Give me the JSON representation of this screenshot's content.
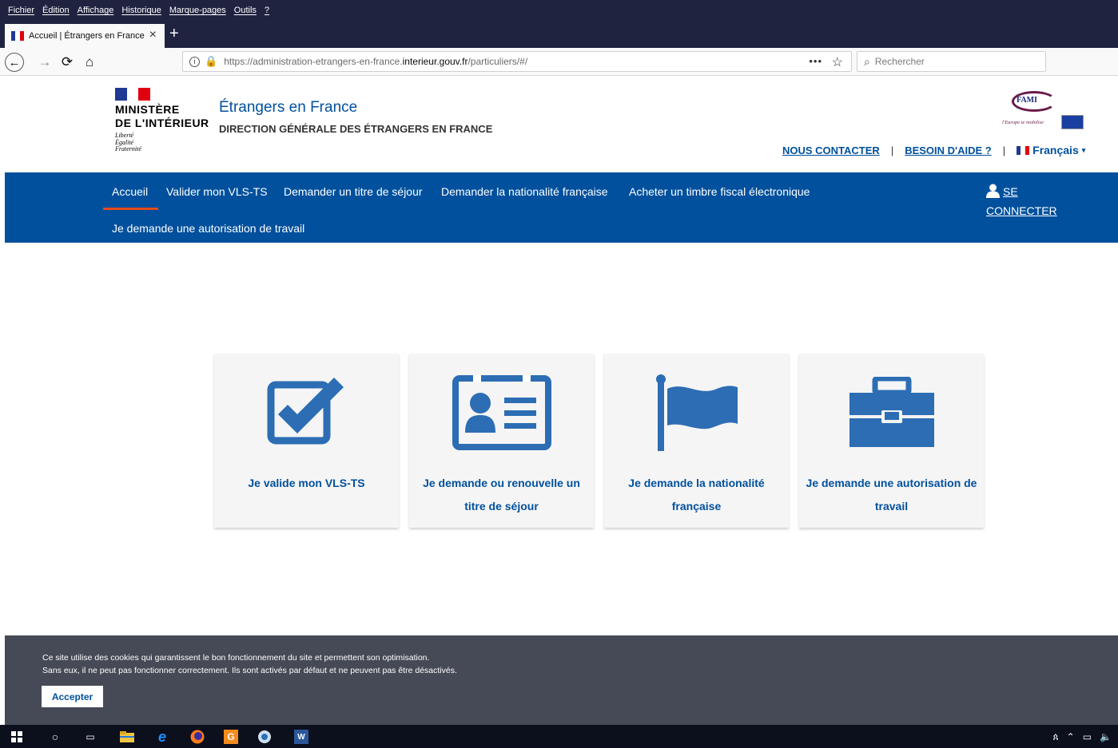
{
  "browser": {
    "menu": [
      "Fichier",
      "Édition",
      "Affichage",
      "Historique",
      "Marque-pages",
      "Outils",
      "?"
    ],
    "tab_title": "Accueil | Étrangers en France",
    "url_prefix": "https://administration-etrangers-en-france.",
    "url_domain": "interieur.gouv.fr",
    "url_suffix": "/particuliers/#/",
    "search_placeholder": "Rechercher"
  },
  "header": {
    "ministry_line1": "MINISTÈRE",
    "ministry_line2": "DE L'INTÉRIEUR",
    "motto_1": "Liberté",
    "motto_2": "Égalité",
    "motto_3": "Fraternité",
    "title": "Étrangers en France",
    "subtitle": "DIRECTION GÉNÉRALE DES ÉTRANGERS EN FRANCE",
    "fami_text": "FAMI",
    "fami_tag": "l'Europe te mobilise",
    "contact": "NOUS CONTACTER",
    "help": "BESOIN D'AIDE ?",
    "language": "Français"
  },
  "nav": {
    "items": [
      "Accueil",
      "Valider mon VLS-TS",
      "Demander un titre de séjour",
      "Demander la nationalité française",
      "Acheter un timbre fiscal électronique"
    ],
    "second_row": "Je demande une autorisation de travail",
    "login_line1": "SE",
    "login_line2": "CONNECTER"
  },
  "cards": [
    {
      "label": "Je valide mon VLS-TS",
      "icon": "checkbox-icon"
    },
    {
      "label": "Je demande ou renouvelle un titre de séjour",
      "icon": "id-card-icon"
    },
    {
      "label": "Je demande la nationalité française",
      "icon": "flag-icon"
    },
    {
      "label": "Je demande une autorisation de travail",
      "icon": "briefcase-icon"
    }
  ],
  "cookie": {
    "line1": "Ce site utilise des cookies qui garantissent le bon fonctionnement du site et permettent son optimisation.",
    "line2": "Sans eux, il ne peut pas fonctionner correctement. Ils sont activés par défaut et ne peuvent pas être désactivés.",
    "accept": "Accepter"
  },
  "colors": {
    "brand_blue": "#00509d",
    "accent_red": "#e64a19",
    "cookie_bg": "#464a56",
    "chrome_dark": "#202340"
  }
}
